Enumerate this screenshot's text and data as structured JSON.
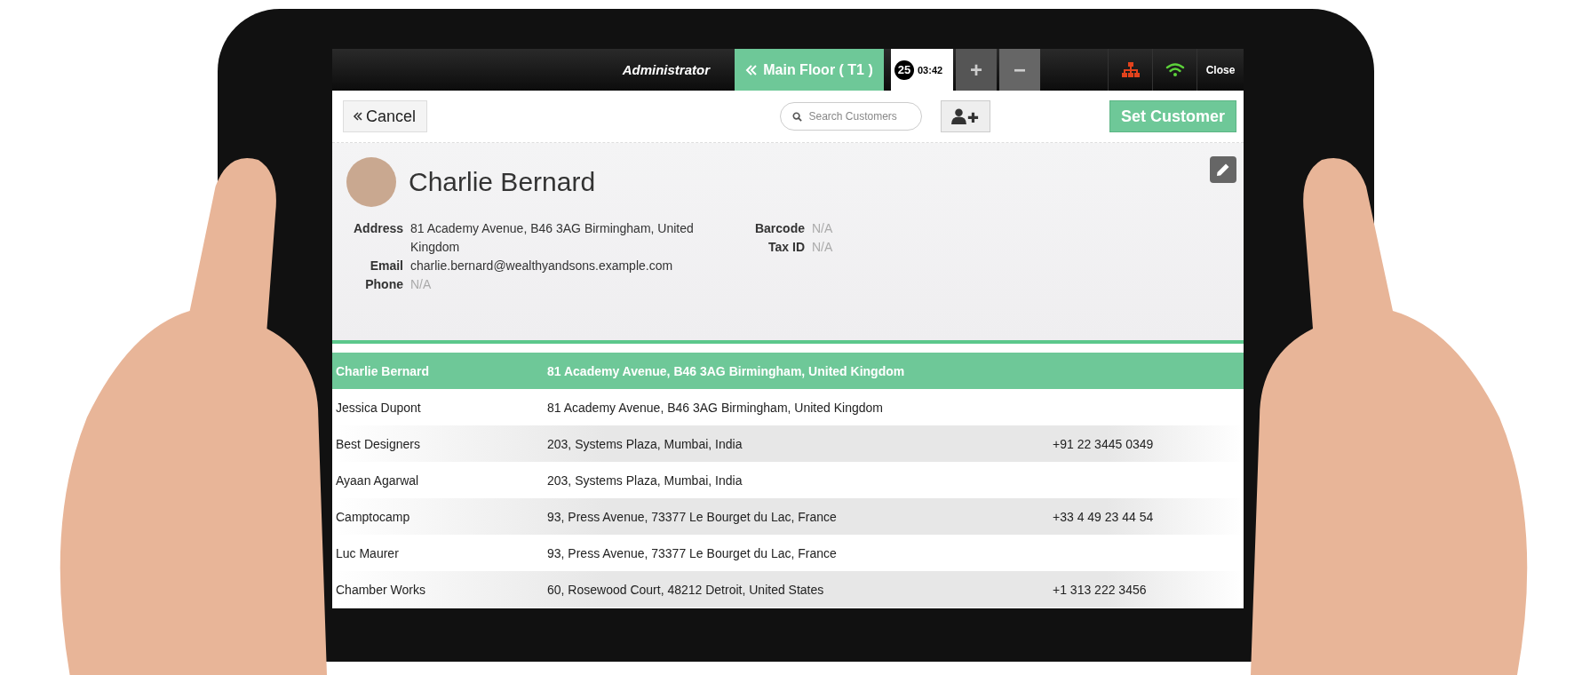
{
  "top_bar": {
    "user": "Administrator",
    "floor_tab": {
      "label": "Main Floor ( T1 )",
      "selected": true
    },
    "orders": [
      {
        "number": "25",
        "time": "03:42",
        "selected": true
      }
    ],
    "order_buttons": [
      "+",
      "−"
    ],
    "close": "Close"
  },
  "toolbar": {
    "cancel": "Cancel",
    "search": {
      "placeholder": "Search Customers"
    },
    "set_customer": "Set Customer"
  },
  "customer": {
    "name": "Charlie Bernard",
    "fields_left": [
      {
        "label": "Address",
        "value": "81 Academy Avenue, B46 3AG Birmingham, United Kingdom",
        "muted": false
      },
      {
        "label": "Email",
        "value": "charlie.bernard@wealthyandsons.example.com",
        "muted": false
      },
      {
        "label": "Phone",
        "value": "N/A",
        "muted": true
      }
    ],
    "fields_right": [
      {
        "label": "Barcode",
        "value": "N/A",
        "muted": true
      },
      {
        "label": "Tax ID",
        "value": "N/A",
        "muted": true
      }
    ]
  },
  "customers": [
    {
      "name": "Charlie Bernard",
      "address": "81 Academy Avenue, B46 3AG Birmingham, United Kingdom",
      "selected": true
    },
    {
      "name": "Jessica Dupont",
      "address": "81 Academy Avenue, B46 3AG Birmingham, United Kingdom",
      "selected": false
    },
    {
      "name": "Best Designers",
      "address": "203, Systems Plaza, Mumbai, India",
      "phone": "+91 22 3445 0349",
      "selected": false
    },
    {
      "name": "Ayaan Agarwal",
      "address": "203, Systems Plaza, Mumbai, India",
      "selected": false
    },
    {
      "name": "Camptocamp",
      "address": "93, Press Avenue, 73377 Le Bourget du Lac, France",
      "phone": "+33 4 49 23 44 54",
      "selected": false
    },
    {
      "name": "Luc Maurer",
      "address": "93, Press Avenue, 73377 Le Bourget du Lac, France",
      "selected": false
    },
    {
      "name": "Chamber Works",
      "address": "60, Rosewood Court, 48212 Detroit, United States",
      "phone": "+1 313 222 3456",
      "selected": false
    }
  ]
}
